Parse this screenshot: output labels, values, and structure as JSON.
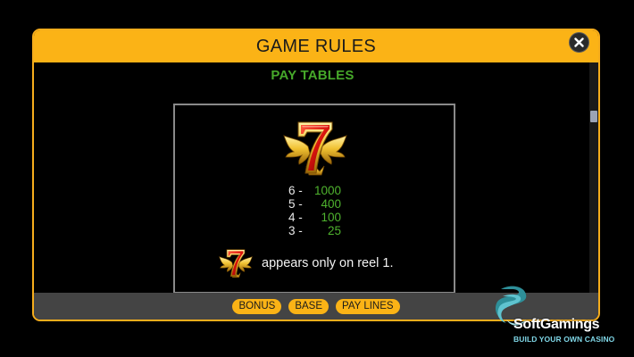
{
  "dialog": {
    "title": "GAME RULES",
    "close_icon": "close-icon",
    "accent_color": "#fbb316",
    "border_color": "#f6ad1c"
  },
  "content": {
    "section_title": "PAY TABLES",
    "section_title_color": "#46a82a",
    "symbol_icon": "winged-red-seven-icon",
    "paytable": [
      {
        "count": "6 -",
        "value": "1000"
      },
      {
        "count": "5 -",
        "value": "400"
      },
      {
        "count": "4 -",
        "value": "100"
      },
      {
        "count": "3 -",
        "value": "25"
      }
    ],
    "value_color": "#4fb32e",
    "note_text": "appears only on reel 1."
  },
  "footer": {
    "tabs": [
      {
        "label": "BONUS"
      },
      {
        "label": "BASE"
      },
      {
        "label": "PAY LINES"
      }
    ]
  },
  "watermark": {
    "brand": "SoftGamings",
    "tagline": "BUILD YOUR OWN CASINO"
  }
}
